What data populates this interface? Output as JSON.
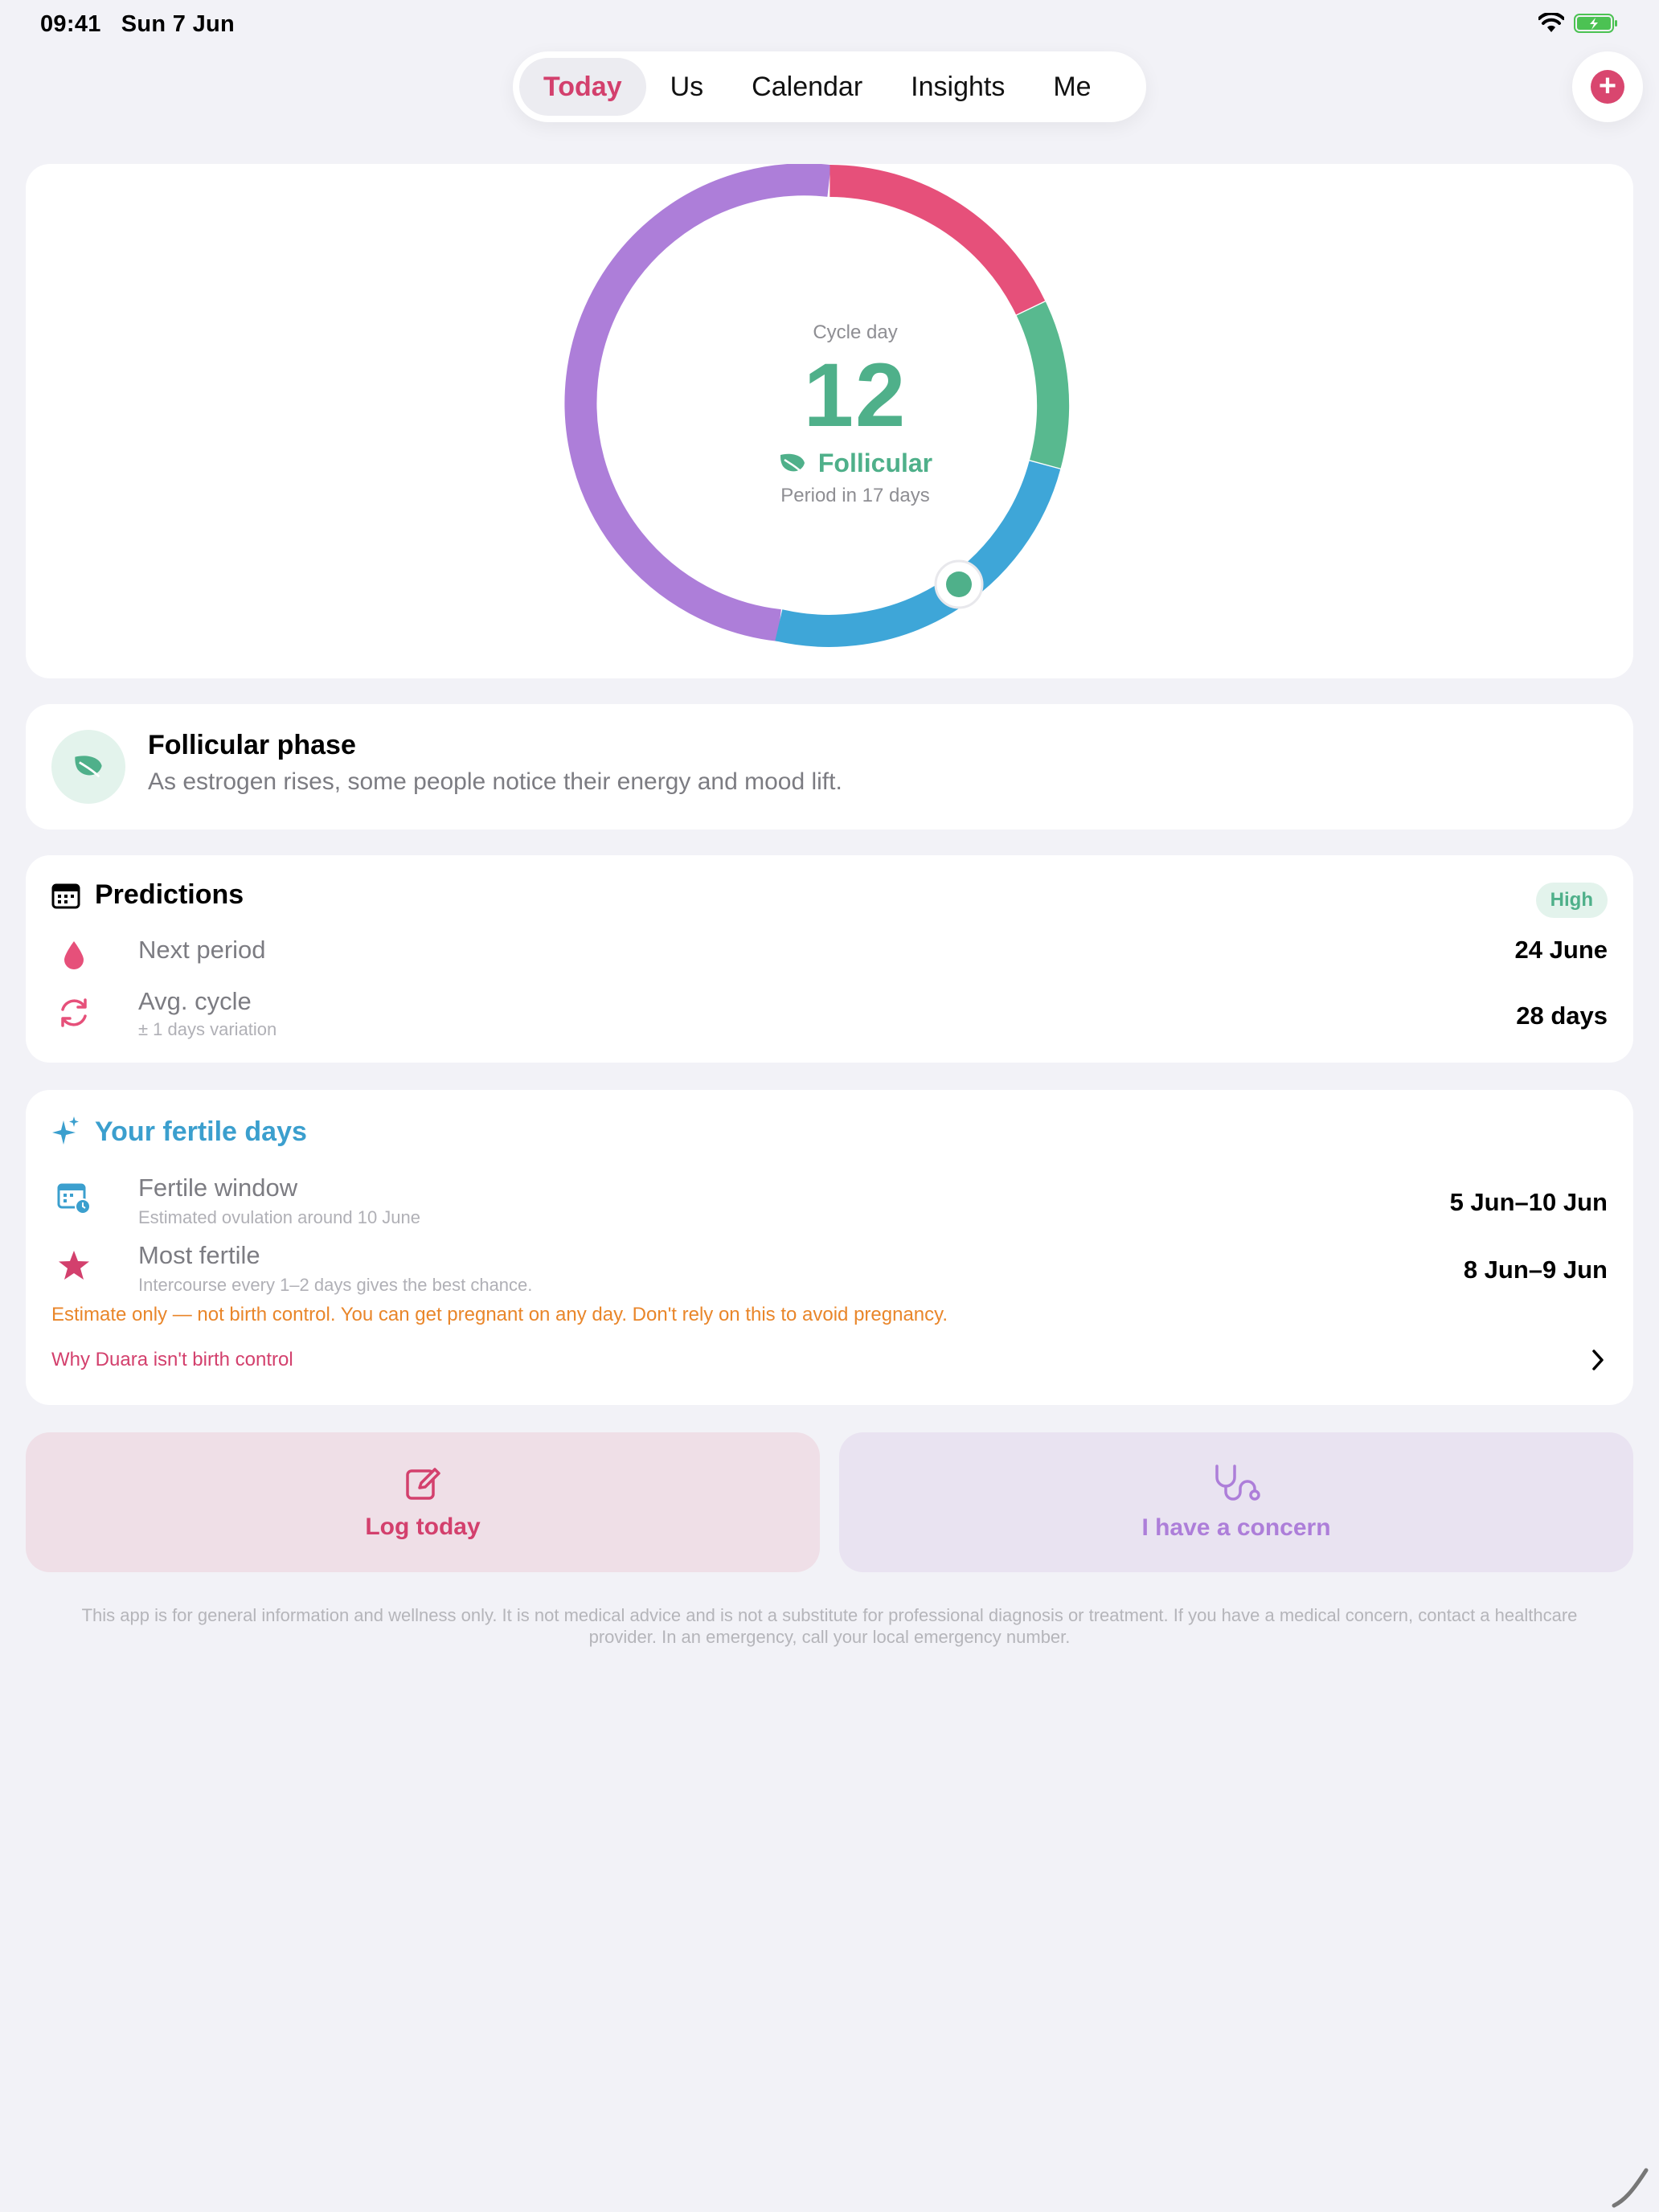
{
  "status_bar": {
    "time": "09:41",
    "date": "Sun 7 Jun"
  },
  "tabs": [
    {
      "label": "Today",
      "active": true
    },
    {
      "label": "Us",
      "active": false
    },
    {
      "label": "Calendar",
      "active": false
    },
    {
      "label": "Insights",
      "active": false
    },
    {
      "label": "Me",
      "active": false
    }
  ],
  "add_button": {
    "icon": "plus-icon"
  },
  "cycle": {
    "label": "Cycle day",
    "day": "12",
    "phase": "Follicular",
    "phase_icon": "leaf-icon",
    "period_text": "Period in 17 days",
    "ring_colors": {
      "menstrual": "#e6507a",
      "fertile": "#58b98f",
      "ovulation": "#3ea6d8",
      "luteal": "#ad7ed9"
    },
    "progress_fraction": 0.39
  },
  "phase_card": {
    "title": "Follicular phase",
    "description": "As estrogen rises, some people notice their energy and mood lift.",
    "icon": "leaf-icon"
  },
  "predictions": {
    "title": "Predictions",
    "icon": "calendar-icon",
    "confidence": "High",
    "rows": [
      {
        "label": "Next period",
        "value": "24 June",
        "icon": "drop-icon"
      },
      {
        "label": "Avg. cycle",
        "sub": "± 1 days variation",
        "value": "28 days",
        "icon": "cycle-arrows-icon"
      }
    ]
  },
  "fertile": {
    "title": "Your fertile days",
    "icon": "sparkles-icon",
    "rows": [
      {
        "label": "Fertile window",
        "sub": "Estimated ovulation around 10 June",
        "value": "5 Jun–10 Jun",
        "icon": "calendar-clock-icon"
      },
      {
        "label": "Most fertile",
        "sub": "Intercourse every 1–2 days gives the best chance.",
        "value": "8 Jun–9 Jun",
        "icon": "star-icon"
      }
    ],
    "warning": "Estimate only — not birth control. You can get pregnant on any day. Don't rely on this to avoid pregnancy.",
    "link": "Why Duara isn't birth control"
  },
  "actions": {
    "log": {
      "label": "Log today",
      "icon": "edit-icon"
    },
    "concern": {
      "label": "I have a concern",
      "icon": "stethoscope-icon"
    }
  },
  "disclaimer": "This app is for general information and wellness only. It is not medical advice and is not a substitute for professional diagnosis or treatment. If you have a medical concern, contact a healthcare provider. In an emergency, call your local emergency number."
}
